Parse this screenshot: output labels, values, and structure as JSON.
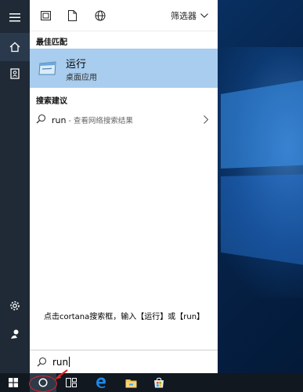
{
  "colors": {
    "rail_bg": "#1f2a36",
    "panel_bg": "#ffffff",
    "best_match_bg": "#a8cdee",
    "taskbar_bg": "#111820",
    "annotation_red": "#e0242a",
    "edge_blue": "#1e88e5"
  },
  "rail": {
    "icons": [
      "hamburger-menu-icon",
      "home-icon",
      "notebook-icon",
      "settings-gear-icon",
      "feedback-icon"
    ]
  },
  "panel": {
    "top_icons": [
      "apps-icon",
      "documents-icon",
      "web-globe-icon"
    ],
    "filter_label": "筛选器",
    "best_match_heading": "最佳匹配",
    "best_match": {
      "title": "运行",
      "subtitle": "桌面应用",
      "icon": "run-app-icon"
    },
    "suggestions_heading": "搜索建议",
    "suggestion": {
      "query": "run",
      "desc": " - 查看网络搜索结果",
      "icon": "search-icon"
    }
  },
  "annotation": "点击cortana搜索框，输入【运行】或【run】",
  "search": {
    "value": "run",
    "icon": "search-icon"
  },
  "taskbar": {
    "items": [
      "windows-start-icon",
      "cortana-circle-icon",
      "task-view-icon",
      "edge-browser-icon",
      "file-explorer-icon",
      "store-icon"
    ]
  }
}
